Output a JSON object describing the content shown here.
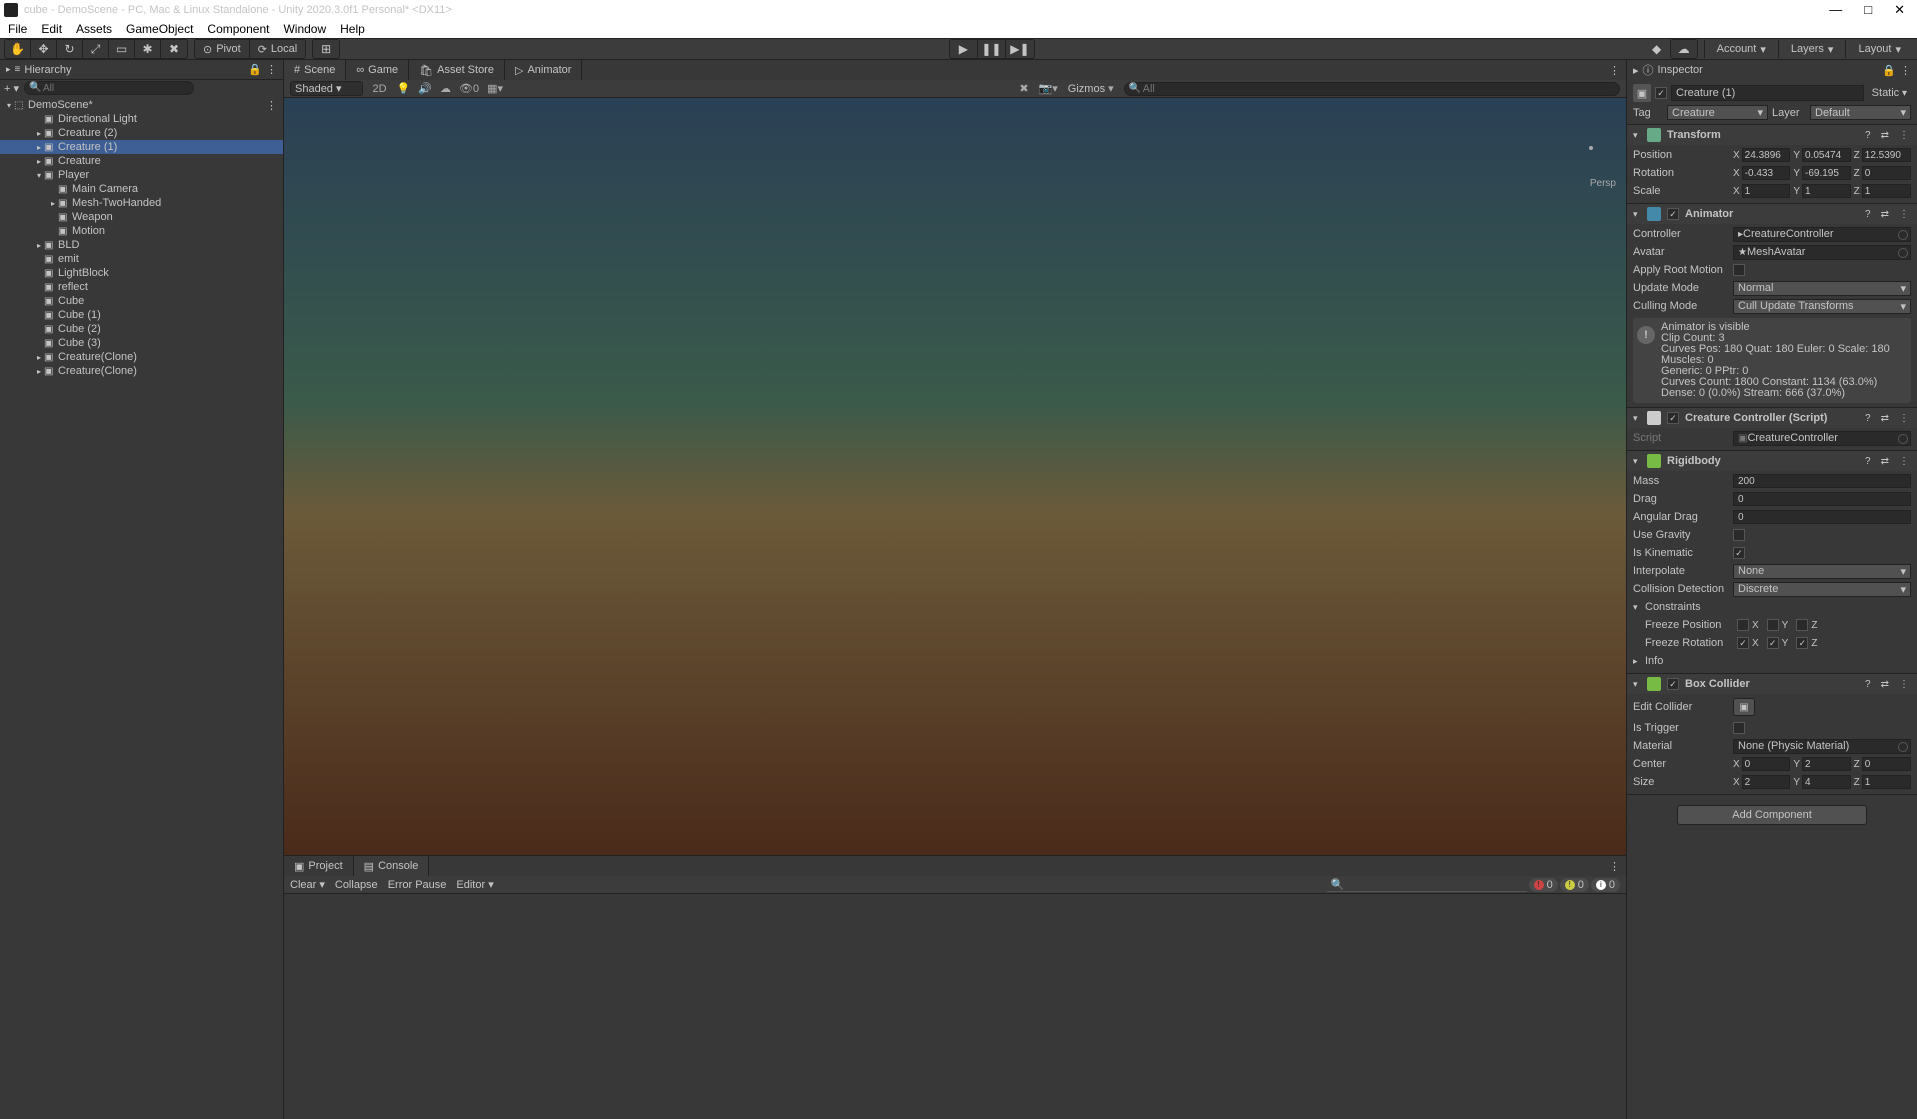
{
  "window": {
    "title": "cube - DemoScene - PC, Mac & Linux Standalone - Unity 2020.3.0f1 Personal* <DX11>"
  },
  "menubar": [
    "File",
    "Edit",
    "Assets",
    "GameObject",
    "Component",
    "Window",
    "Help"
  ],
  "toolbar": {
    "pivot": "Pivot",
    "local": "Local",
    "account": "Account",
    "layers": "Layers",
    "layout": "Layout"
  },
  "hierarchy": {
    "title": "Hierarchy",
    "search_ph": "All",
    "scene": "DemoScene*",
    "items": [
      {
        "d": 1,
        "exp": "",
        "name": "Directional Light"
      },
      {
        "d": 1,
        "exp": "▸",
        "name": "Creature (2)"
      },
      {
        "d": 1,
        "exp": "▸",
        "name": "Creature (1)",
        "sel": true
      },
      {
        "d": 1,
        "exp": "▸",
        "name": "Creature"
      },
      {
        "d": 1,
        "exp": "▾",
        "name": "Player"
      },
      {
        "d": 2,
        "exp": "",
        "name": "Main Camera"
      },
      {
        "d": 2,
        "exp": "▸",
        "name": "Mesh-TwoHanded"
      },
      {
        "d": 2,
        "exp": "",
        "name": "Weapon"
      },
      {
        "d": 2,
        "exp": "",
        "name": "Motion"
      },
      {
        "d": 1,
        "exp": "▸",
        "name": "BLD"
      },
      {
        "d": 1,
        "exp": "",
        "name": "emit"
      },
      {
        "d": 1,
        "exp": "",
        "name": "LightBlock"
      },
      {
        "d": 1,
        "exp": "",
        "name": "reflect"
      },
      {
        "d": 1,
        "exp": "",
        "name": "Cube"
      },
      {
        "d": 1,
        "exp": "",
        "name": "Cube (1)"
      },
      {
        "d": 1,
        "exp": "",
        "name": "Cube (2)"
      },
      {
        "d": 1,
        "exp": "",
        "name": "Cube (3)"
      },
      {
        "d": 1,
        "exp": "▸",
        "name": "Creature(Clone)"
      },
      {
        "d": 1,
        "exp": "▸",
        "name": "Creature(Clone)"
      }
    ]
  },
  "viewtabs": {
    "scene": "Scene",
    "game": "Game",
    "asset": "Asset Store",
    "animator": "Animator"
  },
  "scenebar": {
    "shaded": "Shaded",
    "twod": "2D",
    "gizmos": "Gizmos",
    "search_ph": "All",
    "persp": "Persp"
  },
  "bottom": {
    "project": "Project",
    "console": "Console",
    "clear": "Clear",
    "collapse": "Collapse",
    "errorpause": "Error Pause",
    "editor": "Editor",
    "c_err": "0",
    "c_warn": "0",
    "c_info": "0"
  },
  "inspector": {
    "title": "Inspector",
    "objname": "Creature (1)",
    "static": "Static",
    "tag_lbl": "Tag",
    "tag": "Creature",
    "layer_lbl": "Layer",
    "layer": "Default",
    "transform": {
      "title": "Transform",
      "position_lbl": "Position",
      "pos": {
        "x": "24.3896",
        "y": "0.05474",
        "z": "12.5390"
      },
      "rotation_lbl": "Rotation",
      "rot": {
        "x": "-0.433",
        "y": "-69.195",
        "z": "0"
      },
      "scale_lbl": "Scale",
      "scl": {
        "x": "1",
        "y": "1",
        "z": "1"
      }
    },
    "animator": {
      "title": "Animator",
      "controller_lbl": "Controller",
      "controller": "CreatureController",
      "avatar_lbl": "Avatar",
      "avatar": "MeshAvatar",
      "applyroot_lbl": "Apply Root Motion",
      "update_lbl": "Update Mode",
      "update": "Normal",
      "culling_lbl": "Culling Mode",
      "culling": "Cull Update Transforms",
      "info1": "Animator is visible",
      "info2": "Clip Count: 3",
      "info3": "Curves Pos: 180 Quat: 180 Euler: 0 Scale: 180 Muscles: 0",
      "info4": "Generic: 0 PPtr: 0",
      "info5": "Curves Count: 1800 Constant: 1134 (63.0%) Dense: 0 (0.0%) Stream: 666 (37.0%)"
    },
    "creaturectrl": {
      "title": "Creature Controller (Script)",
      "script_lbl": "Script",
      "script": "CreatureController"
    },
    "rigidbody": {
      "title": "Rigidbody",
      "mass_lbl": "Mass",
      "mass": "200",
      "drag_lbl": "Drag",
      "drag": "0",
      "angdrag_lbl": "Angular Drag",
      "angdrag": "0",
      "usegrav_lbl": "Use Gravity",
      "iskin_lbl": "Is Kinematic",
      "interp_lbl": "Interpolate",
      "interp": "None",
      "coldet_lbl": "Collision Detection",
      "coldet": "Discrete",
      "constraints_lbl": "Constraints",
      "freezepos_lbl": "Freeze Position",
      "freezerot_lbl": "Freeze Rotation",
      "info_lbl": "Info"
    },
    "boxcol": {
      "title": "Box Collider",
      "editcol_lbl": "Edit Collider",
      "istrigger_lbl": "Is Trigger",
      "material_lbl": "Material",
      "material": "None (Physic Material)",
      "center_lbl": "Center",
      "center": {
        "x": "0",
        "y": "2",
        "z": "0"
      },
      "size_lbl": "Size",
      "size": {
        "x": "2",
        "y": "4",
        "z": "1"
      }
    },
    "addcomp": "Add Component"
  }
}
